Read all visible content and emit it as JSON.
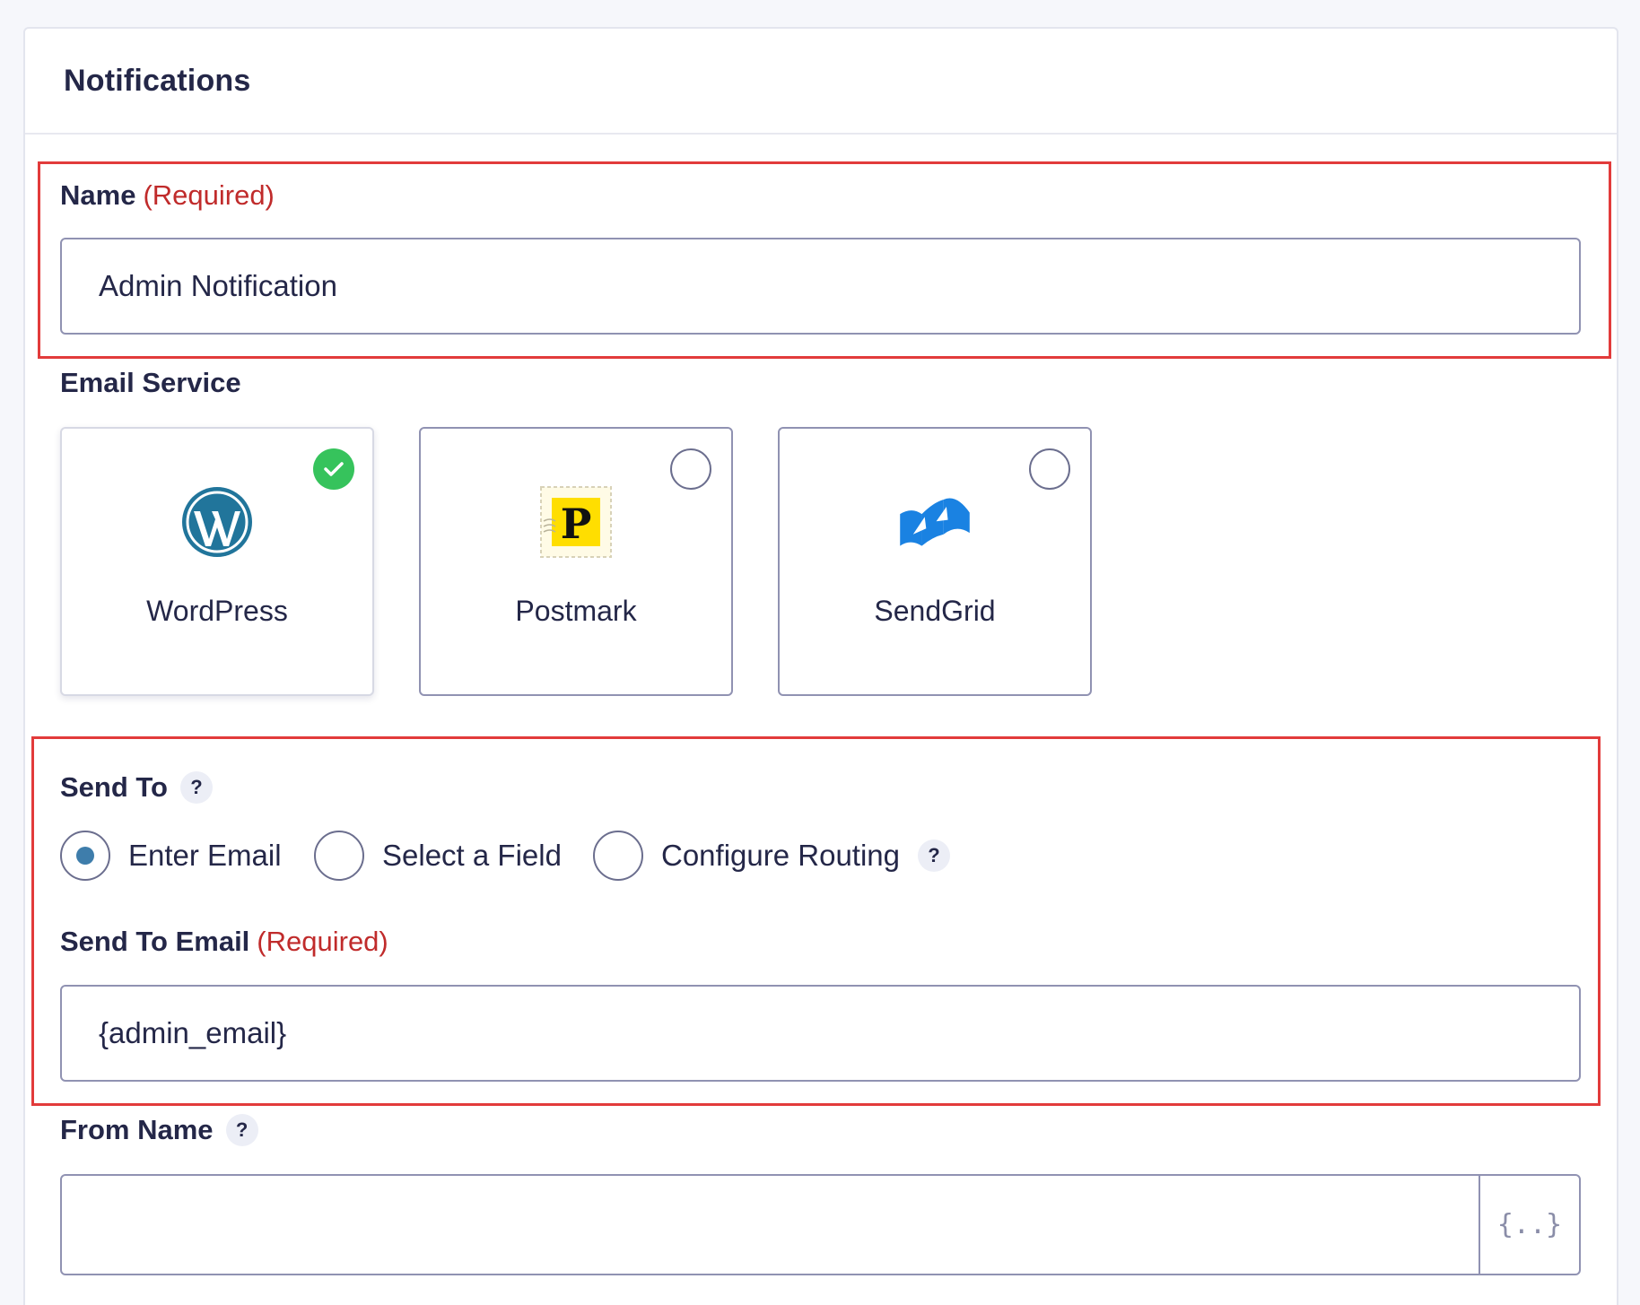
{
  "panel": {
    "title": "Notifications"
  },
  "name_field": {
    "label": "Name",
    "required": "(Required)",
    "value": "Admin Notification"
  },
  "email_service": {
    "label": "Email Service",
    "options": [
      {
        "name": "WordPress",
        "icon": "wordpress-logo-icon",
        "selected": true
      },
      {
        "name": "Postmark",
        "icon": "postmark-logo-icon",
        "selected": false
      },
      {
        "name": "SendGrid",
        "icon": "sendgrid-logo-icon",
        "selected": false
      }
    ]
  },
  "send_to": {
    "label": "Send To",
    "help": "?",
    "options": [
      {
        "label": "Enter Email",
        "checked": true
      },
      {
        "label": "Select a Field",
        "checked": false
      },
      {
        "label": "Configure Routing",
        "checked": false
      }
    ],
    "routing_help": "?"
  },
  "send_to_email": {
    "label": "Send To Email",
    "required": "(Required)",
    "value": "{admin_email}"
  },
  "from_name": {
    "label": "From Name",
    "help": "?",
    "value": "",
    "merge_tag_button": "{..}"
  },
  "colors": {
    "required": "#c02b2b",
    "highlight": "#e23b3b",
    "check": "#36c35c",
    "radio_checked": "#3e7dab",
    "wordpress": "#21759b",
    "postmark": "#ffde00",
    "sendgrid": "#1a82e2"
  }
}
